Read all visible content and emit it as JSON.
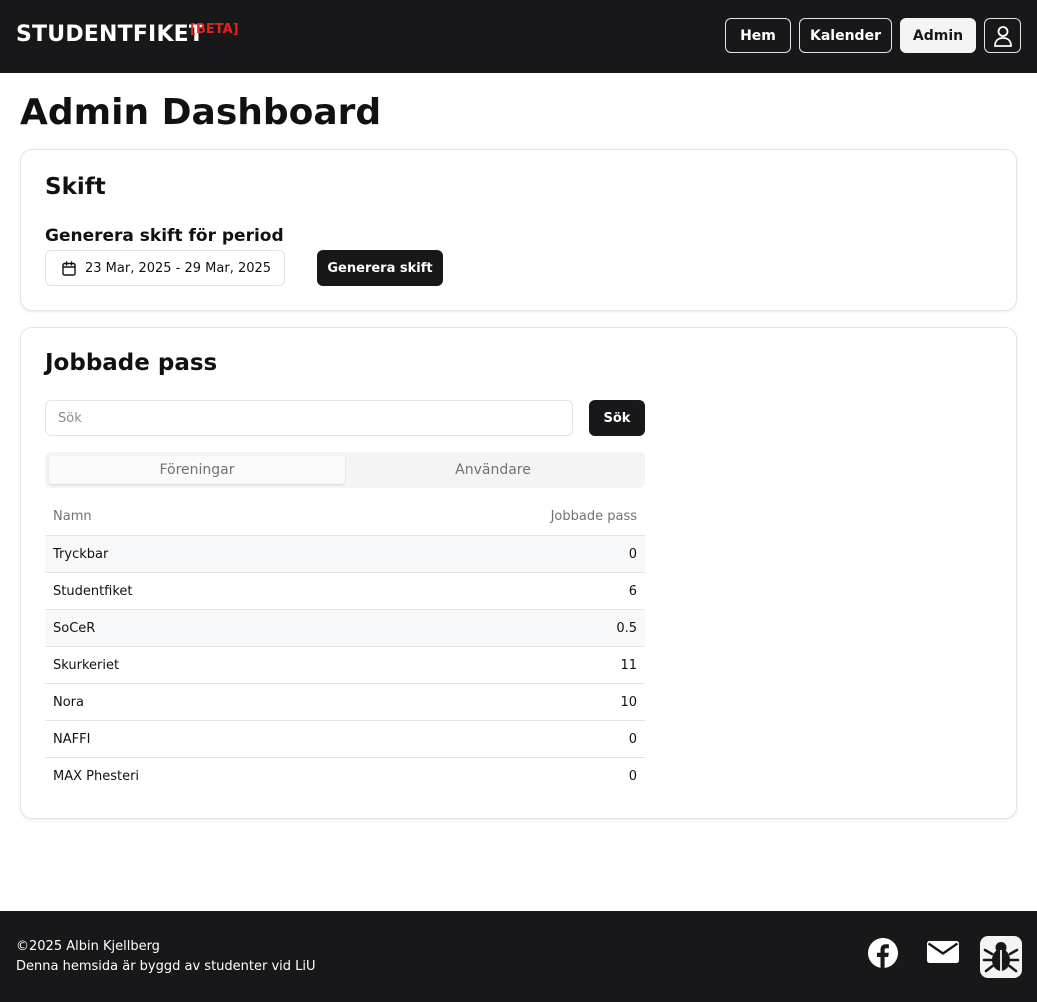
{
  "header": {
    "brand": "STUDENTFIKET",
    "beta": "[BETA]",
    "nav": [
      {
        "label": "Hem"
      },
      {
        "label": "Kalender"
      },
      {
        "label": "Admin"
      }
    ],
    "user_icon": "user-icon"
  },
  "page": {
    "title": "Admin Dashboard"
  },
  "skift": {
    "title": "Skift",
    "subtitle": "Generera skift för period",
    "date_range": "23 Mar, 2025 - 29 Mar, 2025",
    "date_icon": "calendar-icon",
    "generate_label": "Generera skift"
  },
  "pass": {
    "title": "Jobbade pass",
    "search_placeholder": "Sök",
    "search_value": "",
    "search_button": "Sök",
    "tabs": [
      {
        "label": "Föreningar",
        "active": true
      },
      {
        "label": "Användare",
        "active": false
      }
    ],
    "table": {
      "headers": [
        "Namn",
        "Jobbade pass"
      ],
      "rows": [
        {
          "name": "Tryckbar",
          "count": "0"
        },
        {
          "name": "Studentfiket",
          "count": "6"
        },
        {
          "name": "SoCeR",
          "count": "0.5"
        },
        {
          "name": "Skurkeriet",
          "count": "11"
        },
        {
          "name": "Nora",
          "count": "10"
        },
        {
          "name": "NAFFI",
          "count": "0"
        },
        {
          "name": "MAX Phesteri",
          "count": "0"
        }
      ]
    }
  },
  "footer": {
    "copyright": "©2025 Albin Kjellberg",
    "note": "Denna hemsida är byggd av studenter vid LiU",
    "icons": [
      "facebook-icon",
      "mail-icon",
      "bug-icon"
    ]
  },
  "colors": {
    "dark": "#18181b",
    "beta": "#dc2626",
    "border": "#e4e4e7",
    "muted": "#71717a"
  }
}
